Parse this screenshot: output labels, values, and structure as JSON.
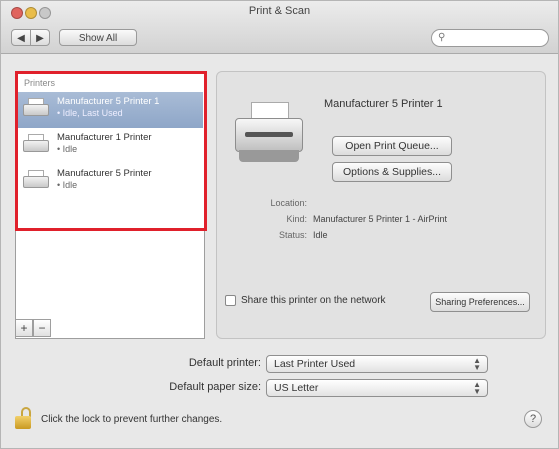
{
  "window": {
    "title": "Print & Scan"
  },
  "toolbar": {
    "back": "◀",
    "forward": "▶",
    "show_all": "Show All",
    "search_placeholder": ""
  },
  "printers": {
    "header": "Printers",
    "items": [
      {
        "name": "Manufacturer 5 Printer 1",
        "status": "• Idle, Last Used",
        "selected": true
      },
      {
        "name": "Manufacturer 1 Printer",
        "status": "• Idle",
        "selected": false
      },
      {
        "name": "Manufacturer 5 Printer",
        "status": "• Idle",
        "selected": false
      }
    ],
    "add": "+",
    "remove": "−"
  },
  "detail": {
    "printer_name": "Manufacturer 5 Printer 1",
    "open_queue": "Open Print Queue...",
    "options_supplies": "Options & Supplies...",
    "location_label": "Location:",
    "location_value": "",
    "kind_label": "Kind:",
    "kind_value": "Manufacturer 5 Printer 1 - AirPrint",
    "status_label": "Status:",
    "status_value": "Idle",
    "share_label": "Share this printer on the network",
    "sharing_prefs": "Sharing Preferences..."
  },
  "defaults": {
    "printer_label": "Default printer:",
    "printer_value": "Last Printer Used",
    "paper_label": "Default paper size:",
    "paper_value": "US Letter"
  },
  "footer": {
    "lock_text": "Click the lock to prevent further changes.",
    "help": "?"
  }
}
